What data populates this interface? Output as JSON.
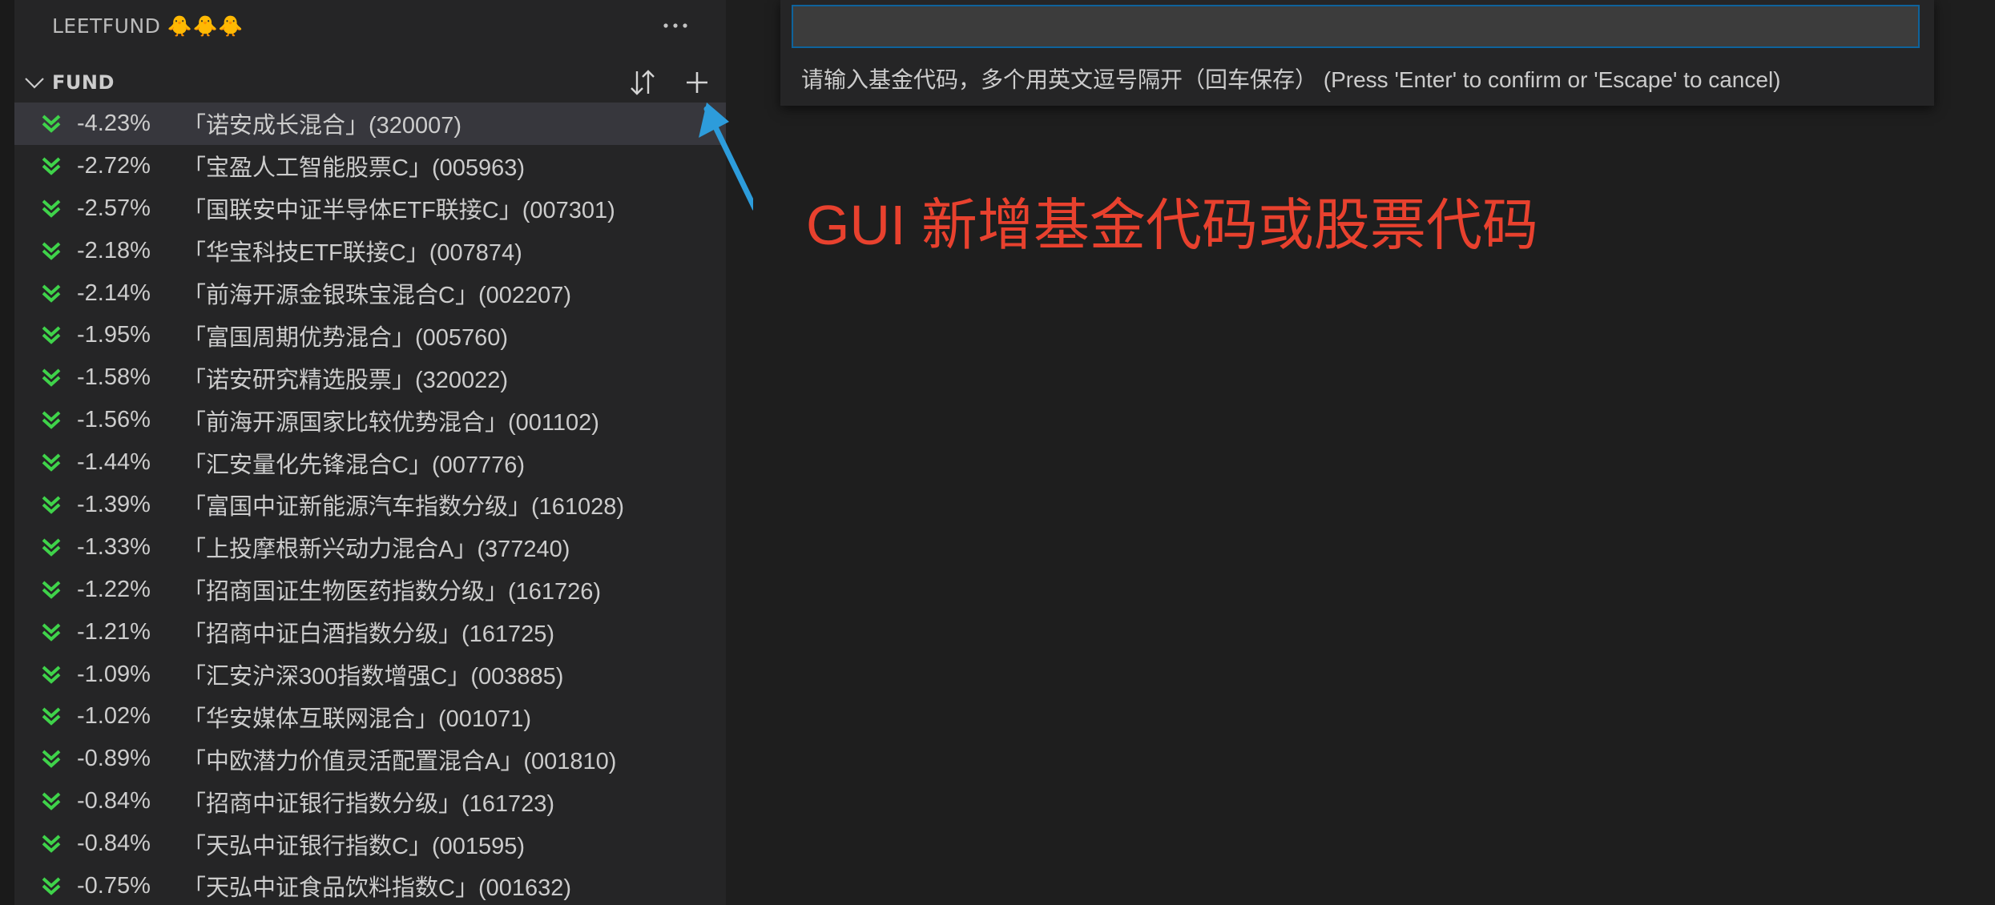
{
  "sidebar": {
    "title": "LEETFUND 🐥🐥🐥",
    "more_icon": "ellipsis-icon",
    "section": {
      "title": "FUND",
      "sort_icon": "sort-icon",
      "add_icon": "plus-icon"
    },
    "funds": [
      {
        "change": "-4.23%",
        "name": "「诺安成长混合」(320007)"
      },
      {
        "change": "-2.72%",
        "name": "「宝盈人工智能股票C」(005963)"
      },
      {
        "change": "-2.57%",
        "name": "「国联安中证半导体ETF联接C」(007301)"
      },
      {
        "change": "-2.18%",
        "name": "「华宝科技ETF联接C」(007874)"
      },
      {
        "change": "-2.14%",
        "name": "「前海开源金银珠宝混合C」(002207)"
      },
      {
        "change": "-1.95%",
        "name": "「富国周期优势混合」(005760)"
      },
      {
        "change": "-1.58%",
        "name": "「诺安研究精选股票」(320022)"
      },
      {
        "change": "-1.56%",
        "name": "「前海开源国家比较优势混合」(001102)"
      },
      {
        "change": "-1.44%",
        "name": "「汇安量化先锋混合C」(007776)"
      },
      {
        "change": "-1.39%",
        "name": "「富国中证新能源汽车指数分级」(161028)"
      },
      {
        "change": "-1.33%",
        "name": "「上投摩根新兴动力混合A」(377240)"
      },
      {
        "change": "-1.22%",
        "name": "「招商国证生物医药指数分级」(161726)"
      },
      {
        "change": "-1.21%",
        "name": "「招商中证白酒指数分级」(161725)"
      },
      {
        "change": "-1.09%",
        "name": "「汇安沪深300指数增强C」(003885)"
      },
      {
        "change": "-1.02%",
        "name": "「华安媒体互联网混合」(001071)"
      },
      {
        "change": "-0.89%",
        "name": "「中欧潜力价值灵活配置混合A」(001810)"
      },
      {
        "change": "-0.84%",
        "name": "「招商中证银行指数分级」(161723)"
      },
      {
        "change": "-0.84%",
        "name": "「天弘中证银行指数C」(001595)"
      },
      {
        "change": "-0.75%",
        "name": "「天弘中证食品饮料指数C」(001632)"
      }
    ],
    "down_icon": "double-chevron-down-icon",
    "down_color": "#3fd34a"
  },
  "quick_input": {
    "value": "",
    "message": "请输入基金代码，多个用英文逗号隔开（回车保存） (Press 'Enter' to confirm or 'Escape' to cancel)"
  },
  "annotation": {
    "text": "GUI 新增基金代码或股票代码",
    "color": "#e8412e",
    "arrow_color": "#2d9cdb"
  },
  "watermark_icon": "vscode-logo-icon"
}
